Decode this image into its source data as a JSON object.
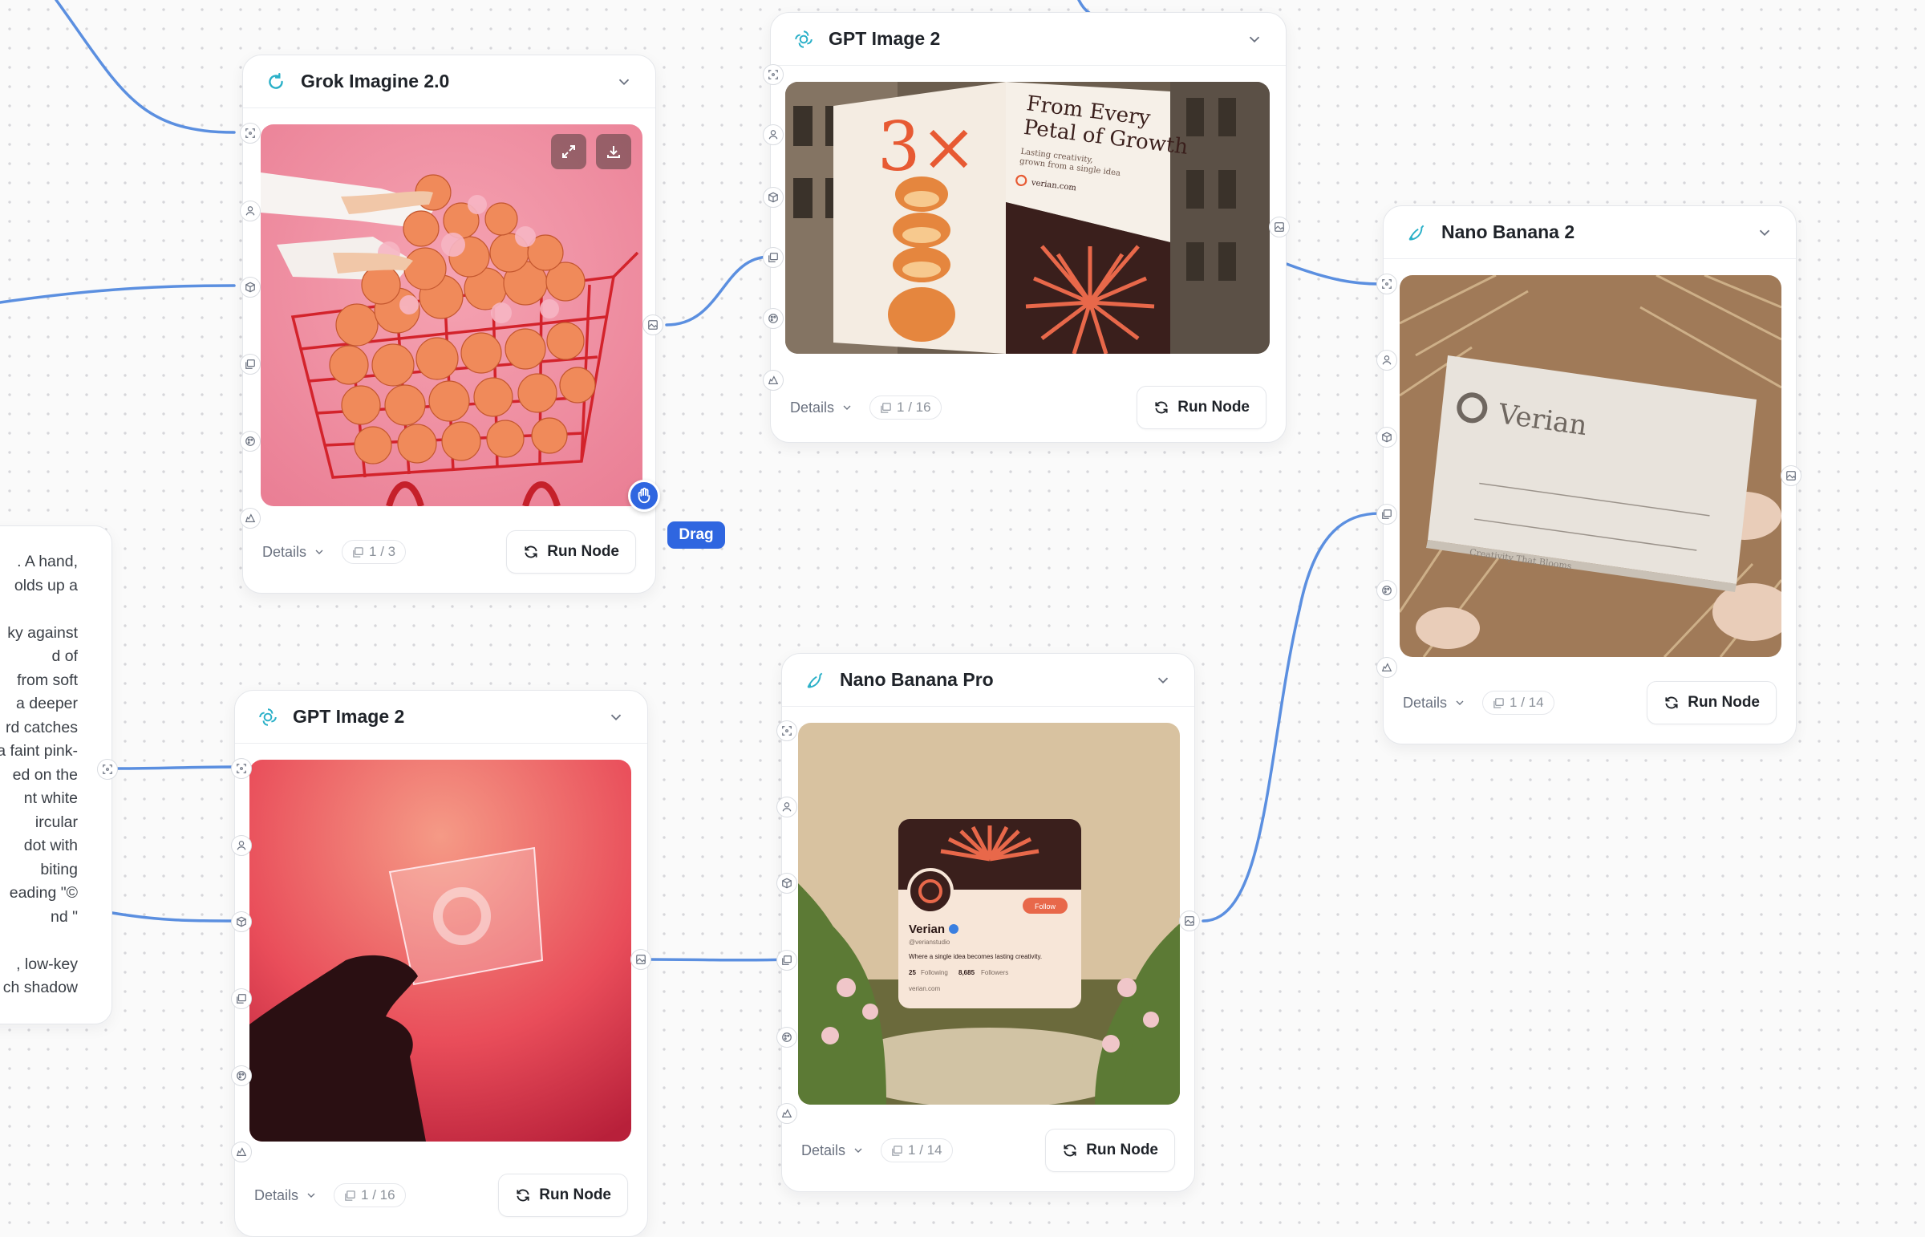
{
  "canvas": {
    "drag_label": "Drag"
  },
  "prompt_card": {
    "text": ". A hand,\nolds up a\n\nky against\nd of\nfrom soft\na deeper\nrd catches\na faint pink-\ned on the\nnt white\nircular\ndot with\nbiting\neading \"©\nnd \"\n\n, low-key\nch shadow"
  },
  "nodes": [
    {
      "id": "grok",
      "title": "Grok Imagine 2.0",
      "details": "Details",
      "counter": "1 / 3",
      "run": "Run Node",
      "icon": "spinner-icon"
    },
    {
      "id": "gpt-top",
      "title": "GPT Image 2",
      "details": "Details",
      "counter": "1 / 16",
      "run": "Run Node",
      "icon": "openai-icon"
    },
    {
      "id": "nano2",
      "title": "Nano Banana 2",
      "details": "Details",
      "counter": "1 / 14",
      "run": "Run Node",
      "icon": "banana-icon"
    },
    {
      "id": "gpt-bottom",
      "title": "GPT Image 2",
      "details": "Details",
      "counter": "1 / 16",
      "run": "Run Node",
      "icon": "openai-icon"
    },
    {
      "id": "nanopro",
      "title": "Nano Banana Pro",
      "details": "Details",
      "counter": "1 / 14",
      "run": "Run Node",
      "icon": "banana-icon"
    }
  ],
  "images": {
    "billboard": {
      "big_text": "3×",
      "headline_1": "From Every",
      "headline_2": "Petal of Growth",
      "sub_1": "Lasting creativity,",
      "sub_2": "grown from a single idea",
      "url": "verian.com"
    },
    "card": {
      "brand": "Verian",
      "tagline": "Creativity That Blooms"
    },
    "profile": {
      "name": "Verian",
      "handle": "@verianstudio",
      "follow": "Follow",
      "bio": "Where a single idea becomes lasting creativity.",
      "following": "25",
      "following_label": "Following",
      "followers": "8,685",
      "followers_label": "Followers",
      "site": "verian.com"
    }
  },
  "colors": {
    "edge": "#5b8fe0",
    "accent": "#2f66e0",
    "node_border": "#e5e7eb"
  }
}
